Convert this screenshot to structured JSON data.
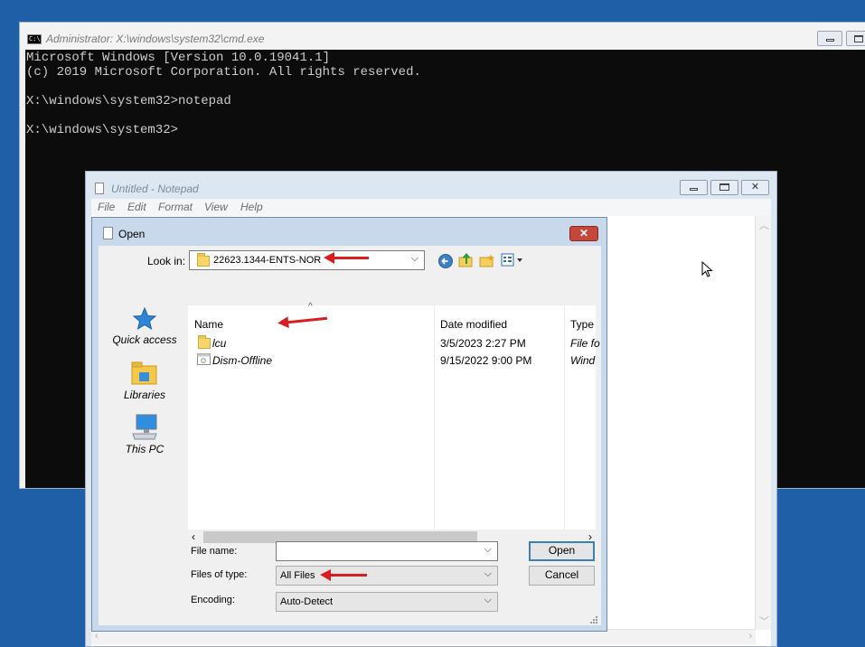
{
  "cmd": {
    "title": "Administrator: X:\\windows\\system32\\cmd.exe",
    "icon_text": "C:\\",
    "lines": [
      "Microsoft Windows [Version 10.0.19041.1]",
      "(c) 2019 Microsoft Corporation. All rights reserved.",
      "",
      "X:\\windows\\system32>notepad",
      "",
      "X:\\windows\\system32>"
    ]
  },
  "notepad": {
    "title": "Untitled - Notepad",
    "menu": [
      "File",
      "Edit",
      "Format",
      "View",
      "Help"
    ]
  },
  "open_dialog": {
    "title": "Open",
    "close_glyph": "✕",
    "look_in_label": "Look in:",
    "look_in_value": "22623.1344-ENTS-NOR",
    "places": [
      "Quick access",
      "Libraries",
      "This PC"
    ],
    "columns": [
      "Name",
      "Date modified",
      "Type"
    ],
    "files": [
      {
        "name": "lcu",
        "date": "3/5/2023 2:27 PM",
        "type": "File fo",
        "icon": "folder-icon"
      },
      {
        "name": "Dism-Offline",
        "date": "9/15/2022 9:00 PM",
        "type": "Wind",
        "icon": "application-icon"
      }
    ],
    "file_name_label": "File name:",
    "file_name_value": "",
    "files_of_type_label": "Files of type:",
    "files_of_type_value": "All Files",
    "encoding_label": "Encoding:",
    "encoding_value": "Auto-Detect",
    "open_button": "Open",
    "cancel_button": "Cancel"
  }
}
